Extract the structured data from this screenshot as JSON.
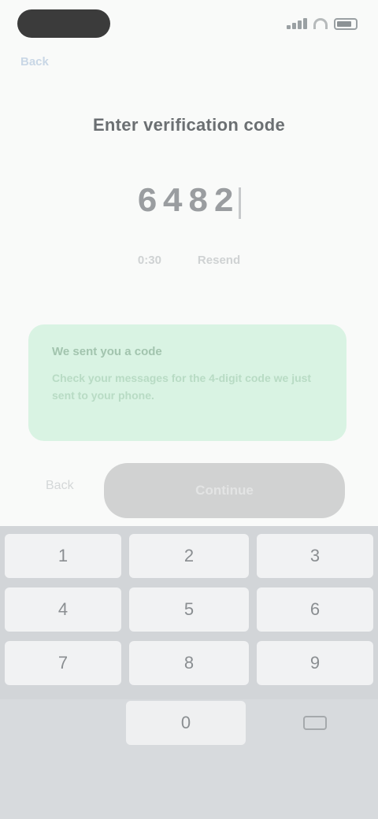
{
  "status_bar": {
    "signal_icon": "signal-icon",
    "wifi_icon": "wifi-icon",
    "battery_icon": "battery-icon"
  },
  "header": {
    "back_label": "Back"
  },
  "verification": {
    "title": "Enter verification code",
    "code_digits": [
      "6",
      "4",
      "8",
      "2"
    ],
    "timer_label": "0:30",
    "resend_label": "Resend"
  },
  "notice": {
    "title": "We sent you a code",
    "body": "Check your messages for the 4-digit code we just sent to your phone."
  },
  "actions": {
    "back_label": "Back",
    "continue_label": "Continue"
  },
  "keyboard": {
    "keys": [
      "1",
      "2",
      "3",
      "4",
      "5",
      "6",
      "7",
      "8",
      "9"
    ],
    "zero": "0",
    "delete_icon": "backspace-icon"
  },
  "colors": {
    "notice_bg": "#d9f3e3",
    "button_disabled": "#d1d2d2",
    "keyboard_bg": "#d2d5d8"
  }
}
